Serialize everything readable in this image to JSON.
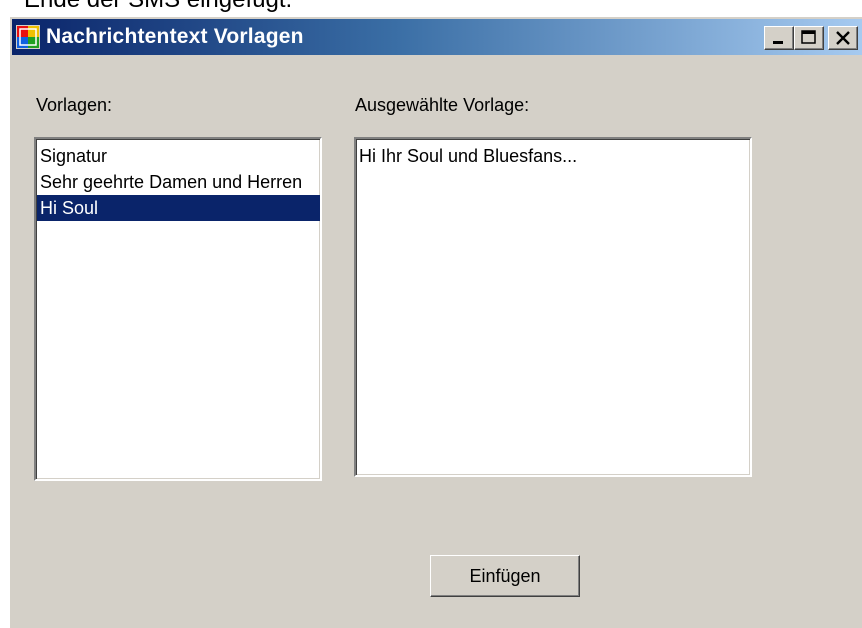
{
  "background": {
    "caption": "Ende der SMS eingefügt."
  },
  "window": {
    "title": "Nachrichtentext Vorlagen",
    "controls": {
      "minimize": "minimize-icon",
      "maximize": "maximize-icon",
      "close": "close-icon"
    },
    "accent_color": "#0a246a",
    "face_color": "#d4d0c8"
  },
  "templates": {
    "label": "Vorlagen:",
    "items": [
      {
        "label": "Signatur",
        "selected": false
      },
      {
        "label": "Sehr geehrte Damen und Herren",
        "selected": false
      },
      {
        "label": "Hi Soul",
        "selected": true
      }
    ]
  },
  "selected_template": {
    "label": "Ausgewählte Vorlage:",
    "text": "Hi Ihr Soul und Bluesfans..."
  },
  "actions": {
    "insert_label": "Einfügen"
  }
}
